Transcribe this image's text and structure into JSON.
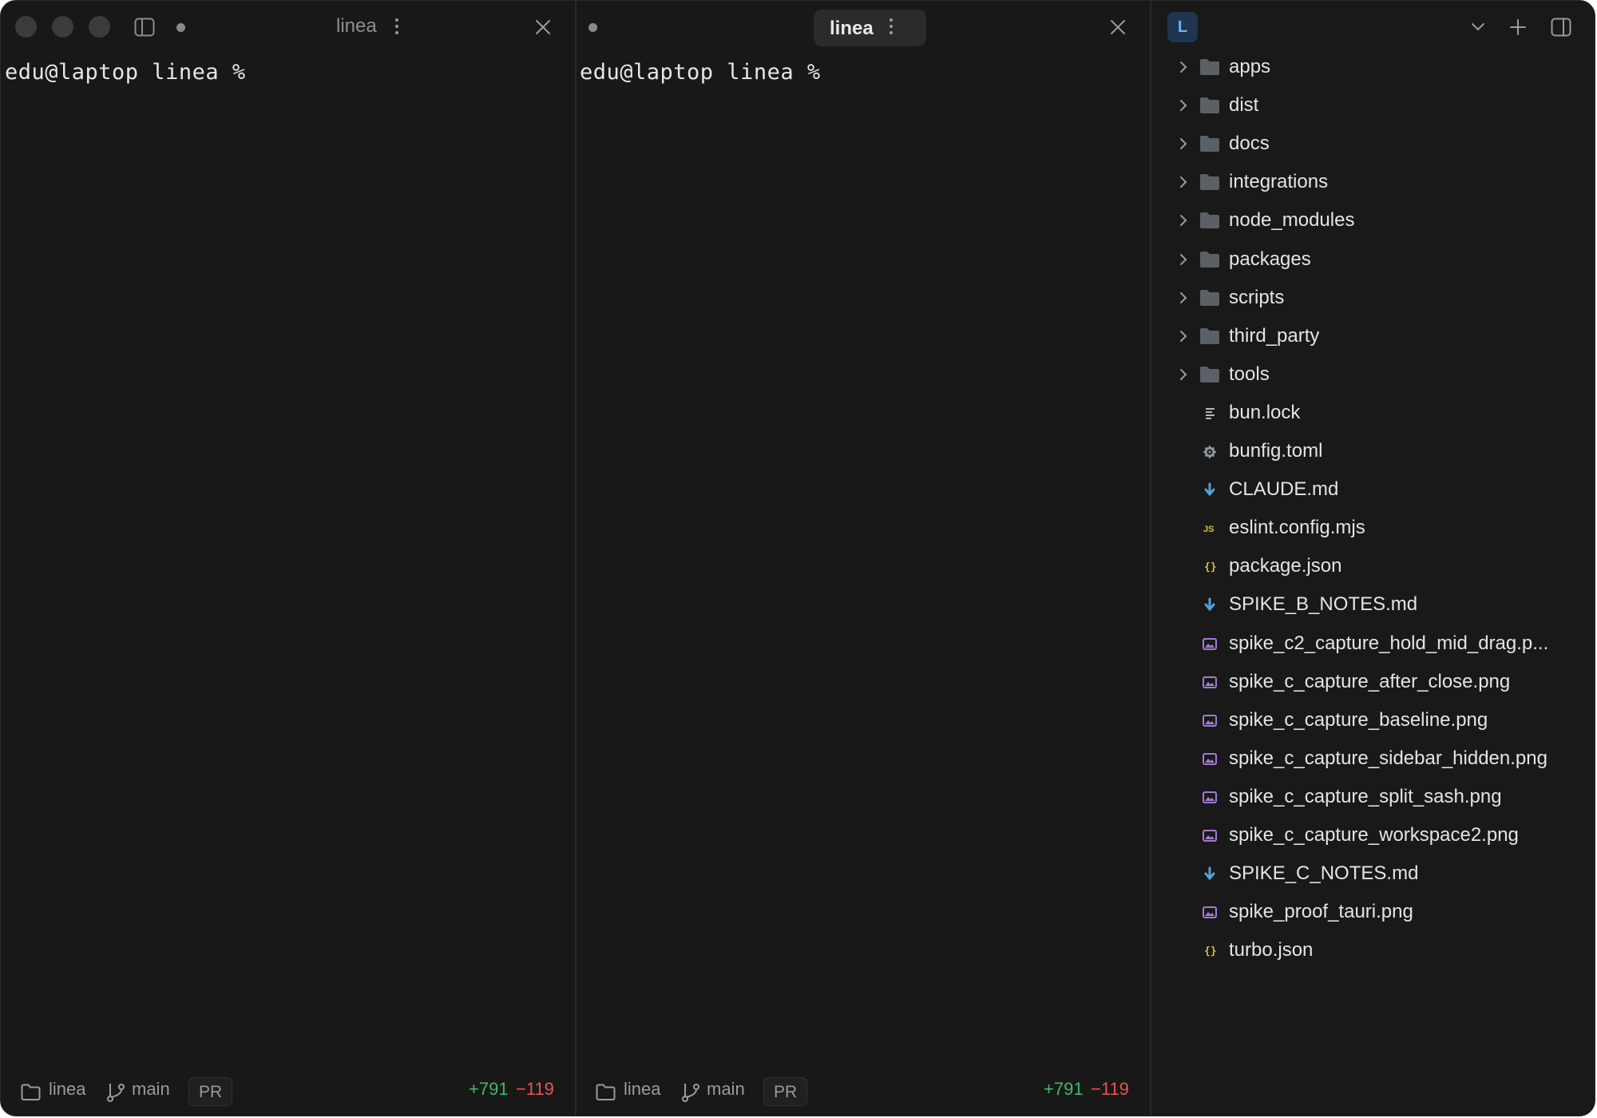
{
  "panes": [
    {
      "tab_title": "linea",
      "prompt": "edu@laptop linea % ",
      "status": {
        "folder": "linea",
        "branch": "main",
        "pr": "PR",
        "added": "+791",
        "removed": "−119"
      }
    },
    {
      "tab_title": "linea",
      "prompt": "edu@laptop linea % ",
      "status": {
        "folder": "linea",
        "branch": "main",
        "pr": "PR",
        "added": "+791",
        "removed": "−119"
      }
    }
  ],
  "sidebar": {
    "workspace_initial": "L",
    "tree": [
      {
        "name": "apps",
        "type": "folder"
      },
      {
        "name": "dist",
        "type": "folder"
      },
      {
        "name": "docs",
        "type": "folder"
      },
      {
        "name": "integrations",
        "type": "folder"
      },
      {
        "name": "node_modules",
        "type": "folder"
      },
      {
        "name": "packages",
        "type": "folder"
      },
      {
        "name": "scripts",
        "type": "folder"
      },
      {
        "name": "third_party",
        "type": "folder"
      },
      {
        "name": "tools",
        "type": "folder"
      },
      {
        "name": "bun.lock",
        "type": "lines-icon"
      },
      {
        "name": "bunfig.toml",
        "type": "gear-icon"
      },
      {
        "name": "CLAUDE.md",
        "type": "markdown-icon"
      },
      {
        "name": "eslint.config.mjs",
        "type": "js-icon"
      },
      {
        "name": "package.json",
        "type": "json-icon"
      },
      {
        "name": "SPIKE_B_NOTES.md",
        "type": "markdown-icon"
      },
      {
        "name": "spike_c2_capture_hold_mid_drag.p...",
        "type": "image-icon"
      },
      {
        "name": "spike_c_capture_after_close.png",
        "type": "image-icon"
      },
      {
        "name": "spike_c_capture_baseline.png",
        "type": "image-icon"
      },
      {
        "name": "spike_c_capture_sidebar_hidden.png",
        "type": "image-icon"
      },
      {
        "name": "spike_c_capture_split_sash.png",
        "type": "image-icon"
      },
      {
        "name": "spike_c_capture_workspace2.png",
        "type": "image-icon"
      },
      {
        "name": "SPIKE_C_NOTES.md",
        "type": "markdown-icon"
      },
      {
        "name": "spike_proof_tauri.png",
        "type": "image-icon"
      },
      {
        "name": "turbo.json",
        "type": "json-icon"
      }
    ]
  },
  "colors": {
    "background": "#181818",
    "added": "#3fb96b",
    "removed": "#ef5050",
    "folder": "#5a6065",
    "markdown": "#4fa3d9",
    "js": "#d7c23a",
    "json": "#d7c23a",
    "image": "#a578d6",
    "workspace_badge": "#1f3550"
  }
}
